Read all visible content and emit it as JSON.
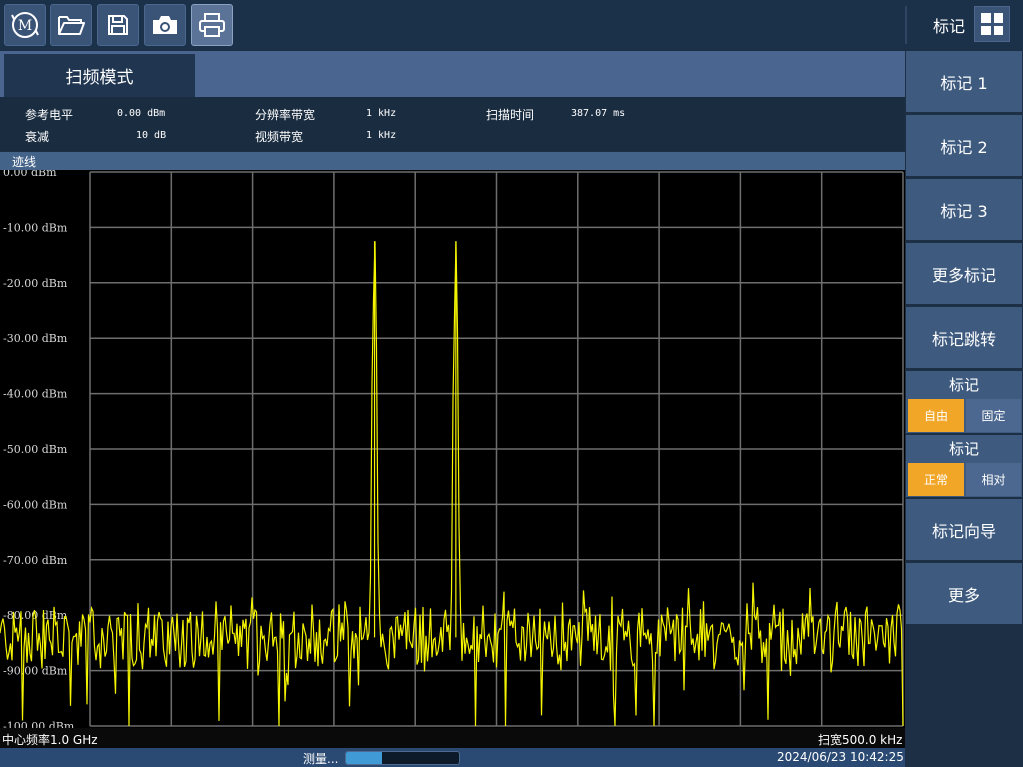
{
  "toolbar": {
    "buttons": [
      {
        "icon": "m-logo-icon"
      },
      {
        "icon": "folder-icon"
      },
      {
        "icon": "save-icon"
      },
      {
        "icon": "camera-icon"
      },
      {
        "icon": "printer-icon"
      }
    ],
    "logo_letter": "M",
    "menu_title": "标记",
    "menu_icon": "grid-icon"
  },
  "tab": {
    "label": "扫频模式"
  },
  "params": {
    "ref_level_label": "参考电平",
    "ref_level_value": "0.00 dBm",
    "atten_label": "衰减",
    "atten_value": "10 dB",
    "rbw_label": "分辨率带宽",
    "rbw_value": "1 kHz",
    "vbw_label": "视频带宽",
    "vbw_value": "1 kHz",
    "sweep_time_label": "扫描时间",
    "sweep_time_value": "387.07 ms"
  },
  "trace_bar": {
    "label": "迹线"
  },
  "chart_data": {
    "type": "line",
    "x_divisions": 10,
    "ylim": [
      -100,
      0
    ],
    "y_tick_labels": [
      "0.00 dBm",
      "-10.00 dBm",
      "-20.00 dBm",
      "-30.00 dBm",
      "-40.00 dBm",
      "-50.00 dBm",
      "-60.00 dBm",
      "-70.00 dBm",
      "-80.00 dBm",
      "-90.00 dBm",
      "-100.00 dBm"
    ],
    "noise_floor_dbm": -84,
    "peaks": [
      {
        "x_fraction": 0.35,
        "level_dbm": -12.5
      },
      {
        "x_fraction": 0.45,
        "level_dbm": -12.5
      }
    ],
    "trace_color": "#f5f500",
    "grid": true
  },
  "status": {
    "center_freq": "中心频率1.0 GHz",
    "span": "扫宽500.0 kHz",
    "measuring": "测量...",
    "progress": 0.32,
    "datetime": "2024/06/23 10:42:25"
  },
  "side_menu": {
    "marker1": "标记 1",
    "marker2": "标记 2",
    "marker3": "标记 3",
    "more_markers": "更多标记",
    "marker_jump": "标记跳转",
    "mode_group": {
      "label": "标记",
      "free": "自由",
      "fixed": "固定"
    },
    "type_group": {
      "label": "标记",
      "normal": "正常",
      "relative": "相对"
    },
    "marker_wizard": "标记向导",
    "more": "更多"
  },
  "colors": {
    "accent": "#f2a628",
    "trace": "#f5f500",
    "panel": "#3e5a7f"
  }
}
